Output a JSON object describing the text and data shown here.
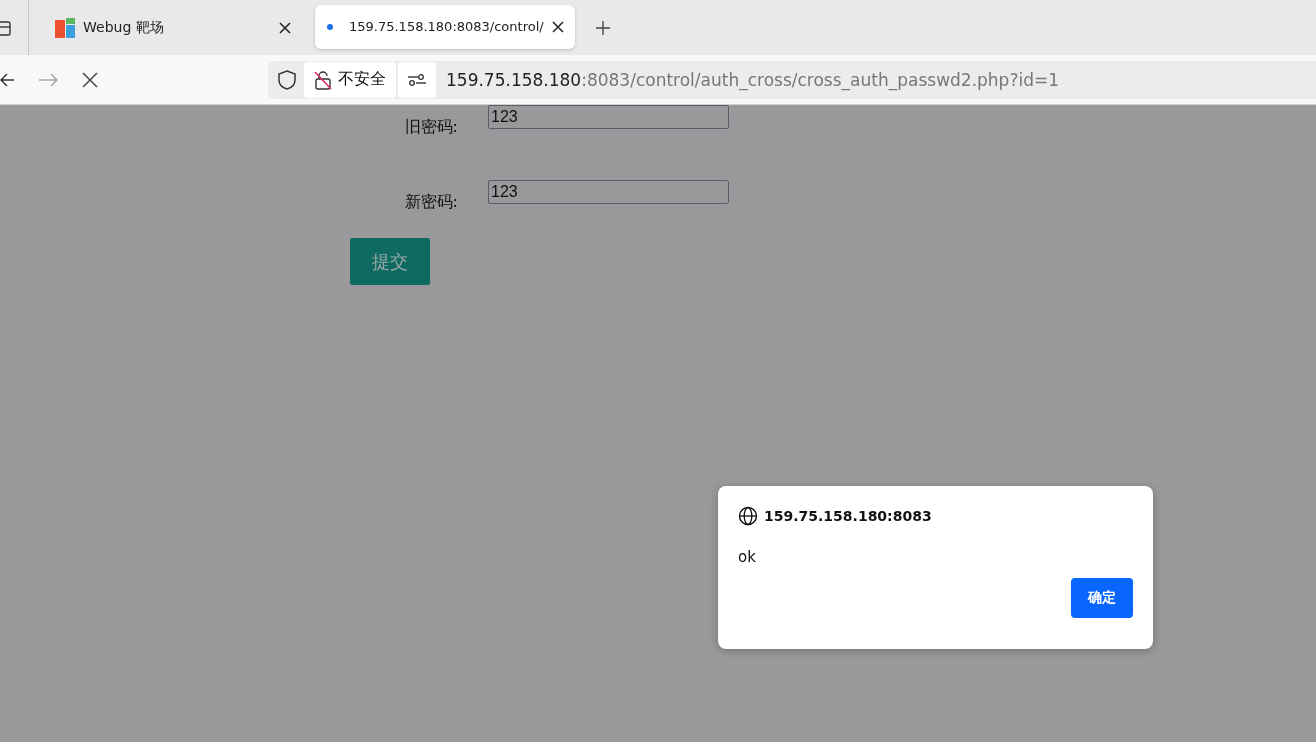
{
  "tabs": [
    {
      "title": "Webug 靶场",
      "selected": false,
      "loading": false
    },
    {
      "title": "159.75.158.180:8083/control/",
      "selected": true,
      "loading": true
    }
  ],
  "address_bar": {
    "security": "不安全",
    "host": "159.75.158.180",
    "path": ":8083/control/auth_cross/cross_auth_passwd2.php?id=1"
  },
  "form": {
    "fields": [
      {
        "label": "旧密码:",
        "value": "123"
      },
      {
        "label": "新密码:",
        "value": "123"
      }
    ],
    "submit": "提交"
  },
  "dialog": {
    "origin": "159.75.158.180:8083",
    "message": "ok",
    "button": "确定"
  }
}
